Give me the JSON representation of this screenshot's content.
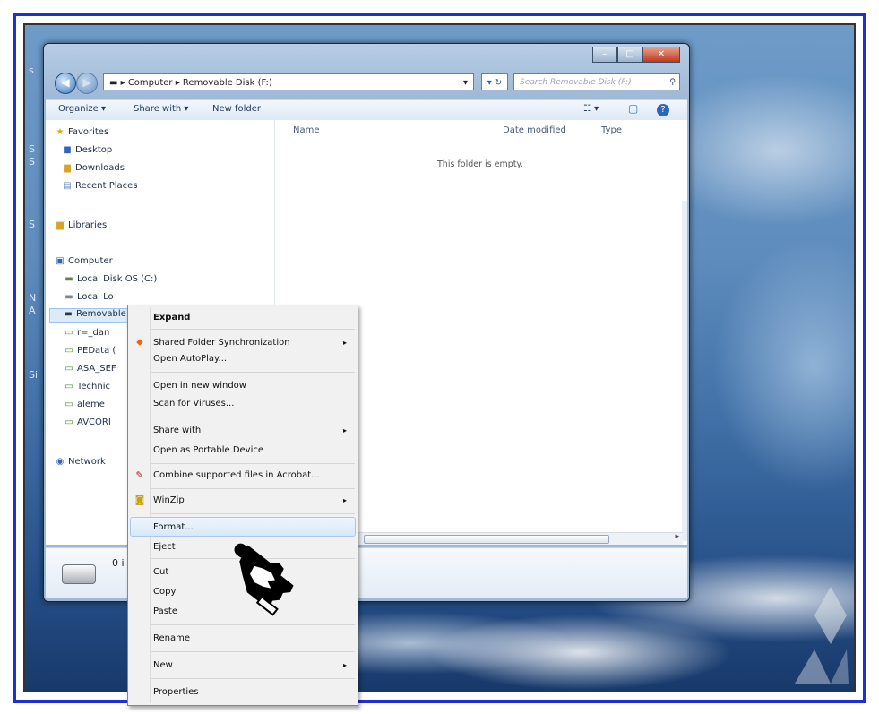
{
  "window": {
    "controls": {
      "minimize": "–",
      "maximize": "□",
      "close": "✕"
    },
    "address": {
      "back_icon": "back-arrow-icon",
      "forward_icon": "forward-arrow-icon",
      "path": "▬ ▸ Computer ▸ Removable Disk (F:)",
      "dropdown": "▾",
      "refresh": "▾ ↻",
      "search_placeholder": "Search Removable Disk (F:)",
      "search_glyph": "⚲"
    },
    "toolbar": {
      "organize": "Organize ▾",
      "share_with": "Share with ▾",
      "new_folder": "New folder",
      "views": "☷ ▾",
      "preview": "▢",
      "help": "?"
    },
    "nav": {
      "favorites": "Favorites",
      "desktop": "Desktop",
      "downloads": "Downloads",
      "recent_places": "Recent Places",
      "libraries": "Libraries",
      "computer": "Computer",
      "local_disk_c": "Local Disk OS (C:)",
      "local_disk_2": "Local Lo",
      "removable": "Removable",
      "net1": "r=_dan",
      "net2": "PEData (",
      "net3": "ASA_SEF",
      "net4": "Technic",
      "net5": "aleme",
      "net6": "AVCORI",
      "network": "Network"
    },
    "columns": {
      "name": "Name",
      "date_modified": "Date modified",
      "type": "Type"
    },
    "empty_message": "This folder is empty.",
    "details": {
      "items": "0 i"
    }
  },
  "context_menu": {
    "items": [
      {
        "label": "Expand",
        "bold": true
      },
      {
        "label": "Shared Folder Synchronization",
        "submenu": true,
        "icon": "sync-icon"
      },
      {
        "label": "Open AutoPlay..."
      },
      {
        "label": "Open in new window"
      },
      {
        "label": "Scan for Viruses..."
      },
      {
        "label": "Share with",
        "submenu": true
      },
      {
        "label": "Open as Portable Device"
      },
      {
        "label": "Combine supported files in Acrobat...",
        "icon": "acrobat-icon"
      },
      {
        "label": "WinZip",
        "submenu": true,
        "icon": "winzip-icon"
      },
      {
        "label": "Format...",
        "highlighted": true
      },
      {
        "label": "Eject"
      },
      {
        "label": "Cut"
      },
      {
        "label": "Copy"
      },
      {
        "label": "Paste"
      },
      {
        "label": "Rename"
      },
      {
        "label": "New",
        "submenu": true
      },
      {
        "label": "Properties"
      }
    ],
    "submenu_arrow": "▸"
  },
  "desktop": {
    "edge_chars": [
      "s",
      "S",
      "S",
      "S",
      "N",
      "A",
      "Si"
    ]
  }
}
